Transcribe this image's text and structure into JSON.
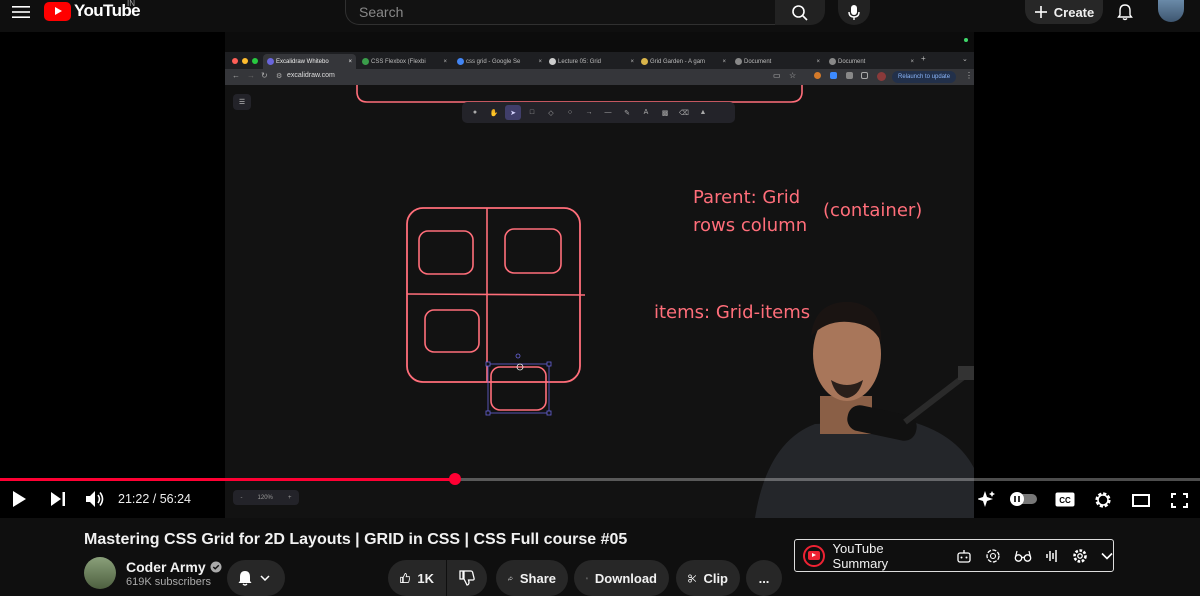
{
  "header": {
    "brand": "YouTube",
    "region": "IN",
    "search_placeholder": "Search",
    "create_label": "Create"
  },
  "video": {
    "current_time": "21:22",
    "duration": "56:24",
    "time_display": "21:22 / 56:24",
    "progress_fraction": 0.379,
    "browser": {
      "tabs": [
        {
          "label": "Excalidraw Whitebo",
          "active": true
        },
        {
          "label": "CSS Flexbox (Flexbi",
          "active": false
        },
        {
          "label": "css grid - Google Se",
          "active": false
        },
        {
          "label": "Lecture 05: Grid",
          "active": false
        },
        {
          "label": "Grid Garden - A gam",
          "active": false
        },
        {
          "label": "Document",
          "active": false
        },
        {
          "label": "Document",
          "active": false
        }
      ],
      "url": "excalidraw.com",
      "relaunch_label": "Relaunch to update"
    },
    "canvas": {
      "note_parent_line1": "Parent: Grid",
      "note_parent_line2": "rows column",
      "note_container": "(container)",
      "note_items": "items: Grid-items",
      "zoom_label": "120%",
      "zoom_minus": "-",
      "zoom_plus": "+"
    }
  },
  "meta": {
    "title": "Mastering CSS Grid for 2D Layouts | GRID in CSS | CSS Full course #05",
    "channel_name": "Coder Army",
    "channel_sub": "619K subscribers",
    "likes": "1K",
    "share_label": "Share",
    "download_label": "Download",
    "clip_label": "Clip",
    "more_label": "...",
    "summary_label": "YouTube Summary"
  },
  "colors": {
    "accent": "#ff0033",
    "brand_red": "#ff0000",
    "sketch": "#ff6e7a"
  }
}
